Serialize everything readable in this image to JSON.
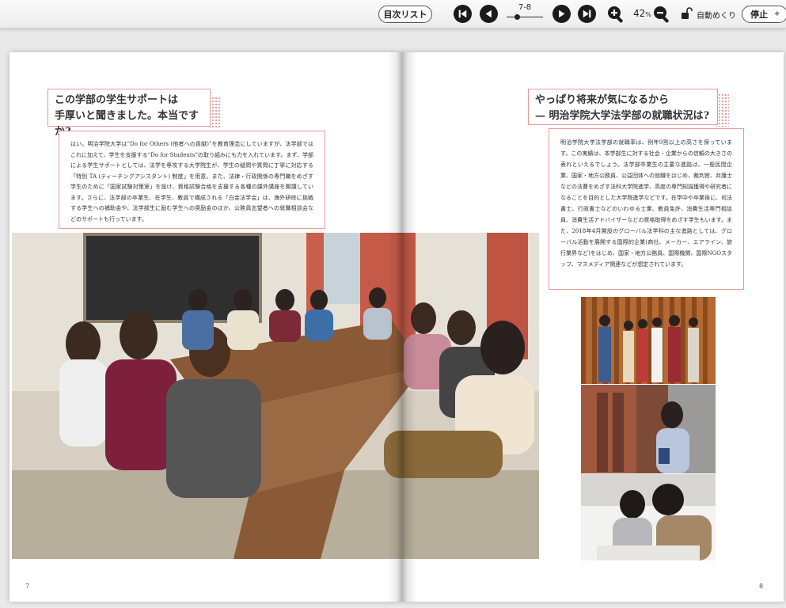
{
  "toolbar": {
    "toc_label": "目次リスト",
    "page_indicator": "7-8",
    "zoom_value": "42",
    "zoom_unit": "%",
    "auto_label": "自動めくり",
    "stop_label": "停止",
    "stop_caret": "÷"
  },
  "icons": {
    "first": "skip-to-first-icon",
    "prev": "previous-page-icon",
    "next": "next-page-icon",
    "last": "skip-to-last-icon",
    "zoom_in": "zoom-in-icon",
    "zoom_out": "zoom-out-icon",
    "lock": "unlock-icon"
  },
  "colors": {
    "accent": "#e59a98",
    "button_dark": "#1b1b1b"
  },
  "pages": {
    "left": {
      "number": "7",
      "question_line1": "この学部の学生サポートは",
      "question_line2": "手厚いと聞きました。本当ですか?",
      "answer": "はい。明治学院大学は“Do for Others (他者への貢献)”を教育理念にしていますが、法学部ではこれに加えて、学生を支援する“Do for Students”の取り組みにも力を入れています。まず、学部による学生サポートとしては、法学を専攻する大学院生が、学生の疑問や質問に丁寧に対応する「特別 TA (ティーチングアシスタント) 制度」を用意。また、法律・行政関係の専門職をめざす学生のために「国家試験対策室」を設け、資格試験合格を支援する各種の課外講座を開講しています。さらに、法学部の卒業生、在学生、教員で構成される「白金法学会」は、海外研修に挑戦する学生への補助金や、法学部生に励む学生への奨励金のほか、公務員志望者への就職相談会などのサポートも行っています。"
    },
    "right": {
      "number": "8",
      "question_line1": "やっぱり将来が気になるから",
      "question_line2": "— 明治学院大学法学部の就職状況は?",
      "answer": "明治学院大学法学部の就職率は、例年9割以上の高さを保っています。この実績は、本学部生に対する社会・企業からの信頼の大きさの表れといえるでしょう。法学部卒業生の主要な進路は、一般民間企業、国家・地方公務員、公益団体への就職をはじめ、裁判官、弁護士などの法曹をめざす法科大学院進学、高度の専門知識獲得や研究者になることを目的とした大学院進学などです。在学中や卒業後に、司法書士、行政書士などのいわゆる士業、教員免許、消費生活専門相談員、消費生活アドバイザーなどの資格取得をめざす学生もいます。また、2018年4月開設のグローバル法学科の主な進路としては、グローバル活動を展開する国際的企業(商社、メーカー、エアライン、旅行業界など)をはじめ、国家・地方公務員、国際機関、国際NGOスタッフ、マスメディア関連などが想定されています。"
    }
  }
}
